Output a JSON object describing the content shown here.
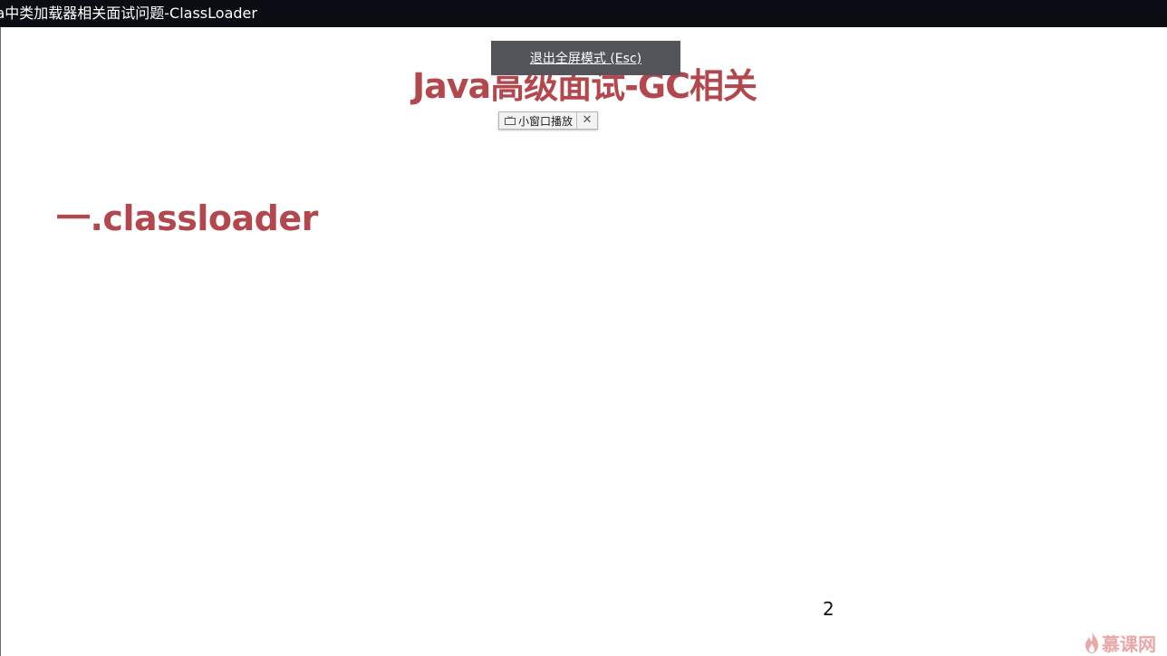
{
  "window": {
    "title": "va中类加载器相关面试问题-ClassLoader"
  },
  "fullscreen_notice": {
    "label": "退出全屏模式 (Esc)"
  },
  "slide": {
    "title": "Java高级面试-GC相关",
    "section_heading": "一.classloader",
    "page_number": "2"
  },
  "pip_toolbar": {
    "label": "小窗口播放",
    "close_symbol": "✕",
    "icon": "tv-icon"
  },
  "watermark": {
    "text": "慕课网",
    "icon": "flame-icon",
    "color": "#e8a8a8"
  },
  "colors": {
    "accent": "#b2484d",
    "titlebar": "#0a0d14",
    "notice_bg": "#53555a"
  }
}
